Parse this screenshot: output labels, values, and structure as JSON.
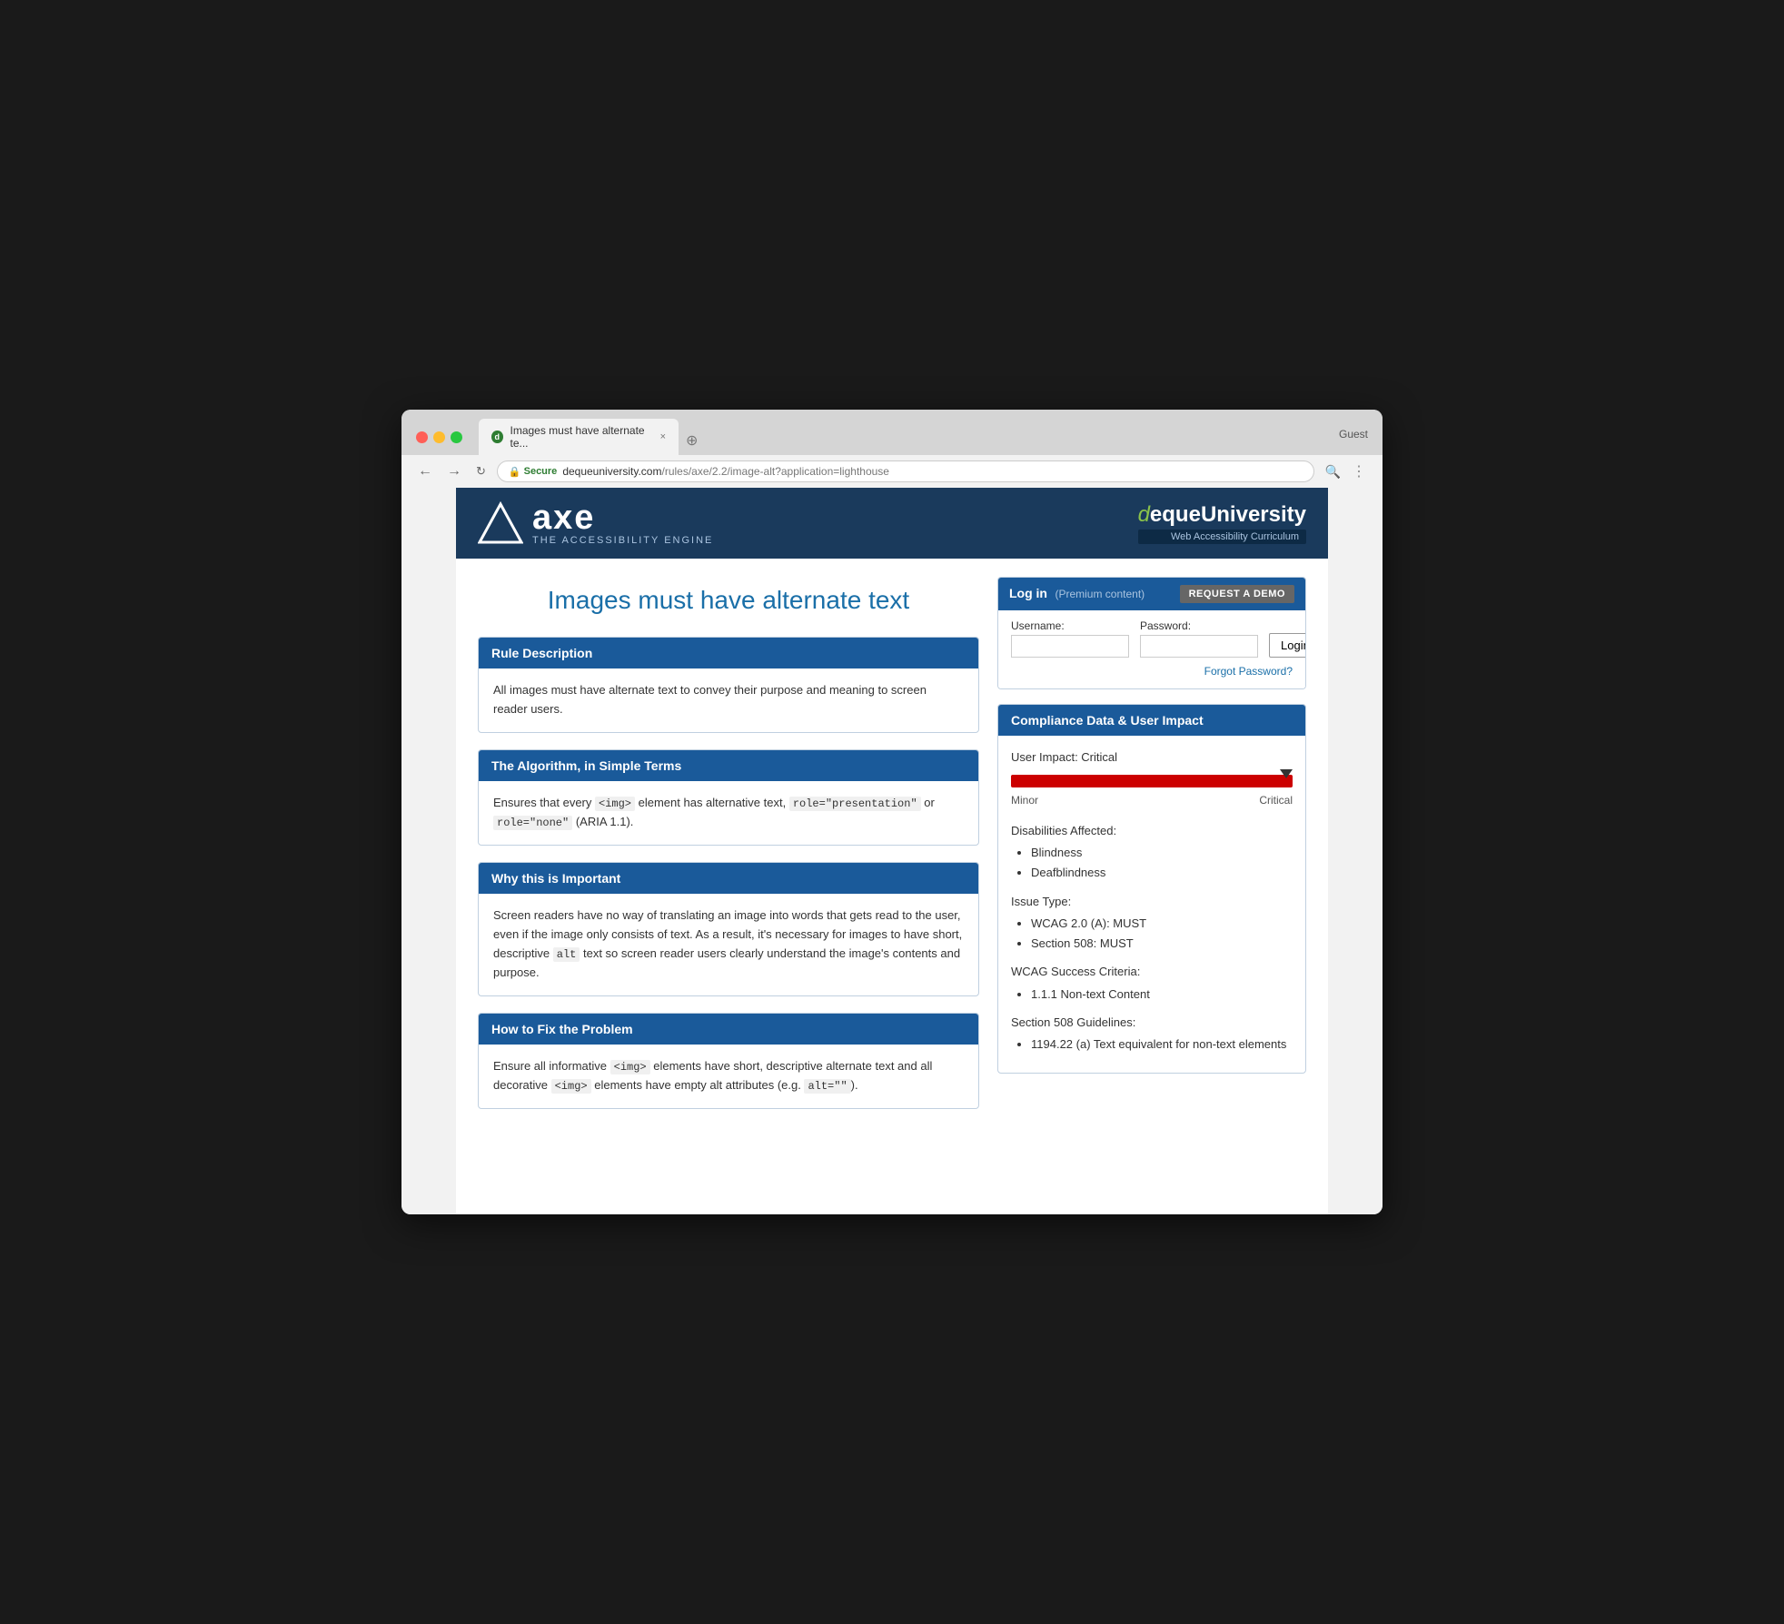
{
  "browser": {
    "tab_title": "Images must have alternate te...",
    "tab_close": "×",
    "guest_label": "Guest",
    "url_secure": "Secure",
    "url_full": "https://dequeuniversity.com/rules/axe/2.2/image-alt?application=lighthouse",
    "url_domain": "dequeuniversity.com",
    "url_path": "/rules/axe/2.2/image-alt?application=lighthouse"
  },
  "header": {
    "logo_tagline": "THE ACCESSIBILITY ENGINE",
    "axe_name": "axe",
    "deque_prefix": "d",
    "deque_name": "equeUniversity",
    "deque_subtitle": "Web Accessibility Curriculum"
  },
  "page": {
    "title": "Images must have alternate text"
  },
  "login": {
    "title": "Log in",
    "premium_label": "(Premium content)",
    "request_demo": "REQUEST A DEMO",
    "username_label": "Username:",
    "password_label": "Password:",
    "login_btn": "Login",
    "forgot_password": "Forgot Password?"
  },
  "rule_description": {
    "heading": "Rule Description",
    "body": "All images must have alternate text to convey their purpose and meaning to screen reader users."
  },
  "algorithm": {
    "heading": "The Algorithm, in Simple Terms",
    "body_parts": [
      "Ensures that every ",
      " element has alternative text, ",
      " or ",
      " (ARIA 1.1)."
    ],
    "code1": "<img>",
    "code2": "role=\"presentation\"",
    "code3": "role=\"none\""
  },
  "importance": {
    "heading": "Why this is Important",
    "body_start": "Screen readers have no way of translating an image into words that gets read to the user, even if the image only consists of text. As a result, it's necessary for images to have short, descriptive ",
    "code": "alt",
    "body_end": " text so screen reader users clearly understand the image's contents and purpose."
  },
  "fix": {
    "heading": "How to Fix the Problem",
    "body_start": "Ensure all informative ",
    "code1": "<img>",
    "body_mid1": " elements have short, descriptive alternate text and all decorative ",
    "code2": "<img>",
    "body_mid2": " elements have empty alt attributes (e.g. ",
    "code3": "alt=\"\"",
    "body_end": ")."
  },
  "compliance": {
    "heading": "Compliance Data & User Impact",
    "user_impact_label": "User Impact: Critical",
    "bar_label_minor": "Minor",
    "bar_label_critical": "Critical",
    "disabilities_heading": "Disabilities Affected:",
    "disabilities": [
      "Blindness",
      "Deafblindness"
    ],
    "issue_type_heading": "Issue Type:",
    "issue_types": [
      "WCAG 2.0 (A): MUST",
      "Section 508: MUST"
    ],
    "wcag_heading": "WCAG Success Criteria:",
    "wcag_items": [
      "1.1.1 Non-text Content"
    ],
    "section508_heading": "Section 508 Guidelines:",
    "section508_items": [
      "1194.22 (a) Text equivalent for non-text elements"
    ]
  }
}
